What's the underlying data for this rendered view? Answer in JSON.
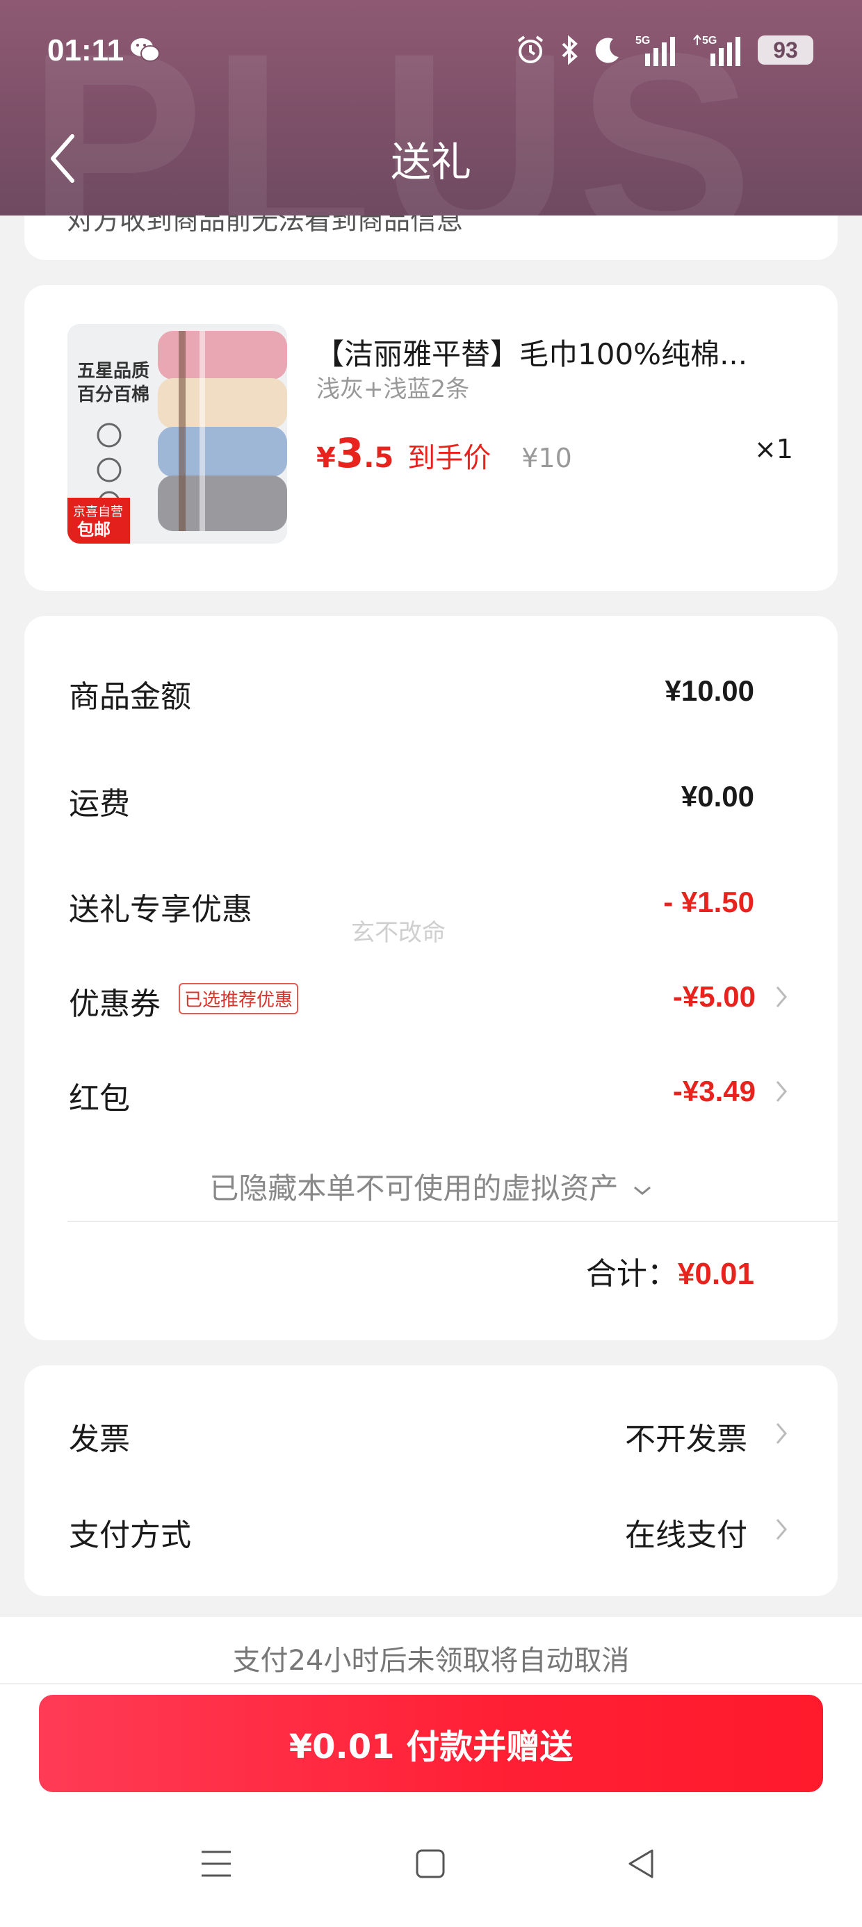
{
  "status_bar": {
    "time": "01:11",
    "network_1": "5G",
    "network_2": "5G",
    "battery": "93"
  },
  "header": {
    "title": "送礼",
    "watermark": "PLUS"
  },
  "top_card": {
    "hint": "对方收到商品前无法看到商品信息"
  },
  "product": {
    "title": "【洁丽雅平替】毛巾100%纯棉...",
    "spec": "浅灰+浅蓝2条",
    "price_symbol": "¥",
    "price_int": "3",
    "price_dec": ".5",
    "price_tag": "到手价",
    "original_price": "¥10",
    "quantity": "×1",
    "image": {
      "badge_line1": "五星品质",
      "badge_line2": "百分百棉",
      "tag_top": "京喜自营",
      "tag_bottom": "包邮"
    }
  },
  "amounts": {
    "goods_label": "商品金额",
    "goods_value": "¥10.00",
    "shipping_label": "运费",
    "shipping_value": "¥0.00",
    "gift_discount_label": "送礼专享优惠",
    "gift_discount_value": "- ¥1.50",
    "coupon_label": "优惠券",
    "coupon_badge": "已选推荐优惠",
    "coupon_value": "-¥5.00",
    "redpacket_label": "红包",
    "redpacket_value": "-¥3.49",
    "hidden_assets": "已隐藏本单不可使用的虚拟资产",
    "total_label": "合计：",
    "total_value": "¥0.01",
    "watermark_text": "玄不改命"
  },
  "invoice": {
    "invoice_label": "发票",
    "invoice_value": "不开发票",
    "payment_label": "支付方式",
    "payment_value": "在线支付"
  },
  "footer": {
    "notice": "支付24小时后未领取将自动取消",
    "pay_button": "¥0.01 付款并赠送"
  },
  "colors": {
    "accent_red": "#e8231e",
    "header_bg": "#7d5068",
    "button_red": "#ff2235"
  }
}
